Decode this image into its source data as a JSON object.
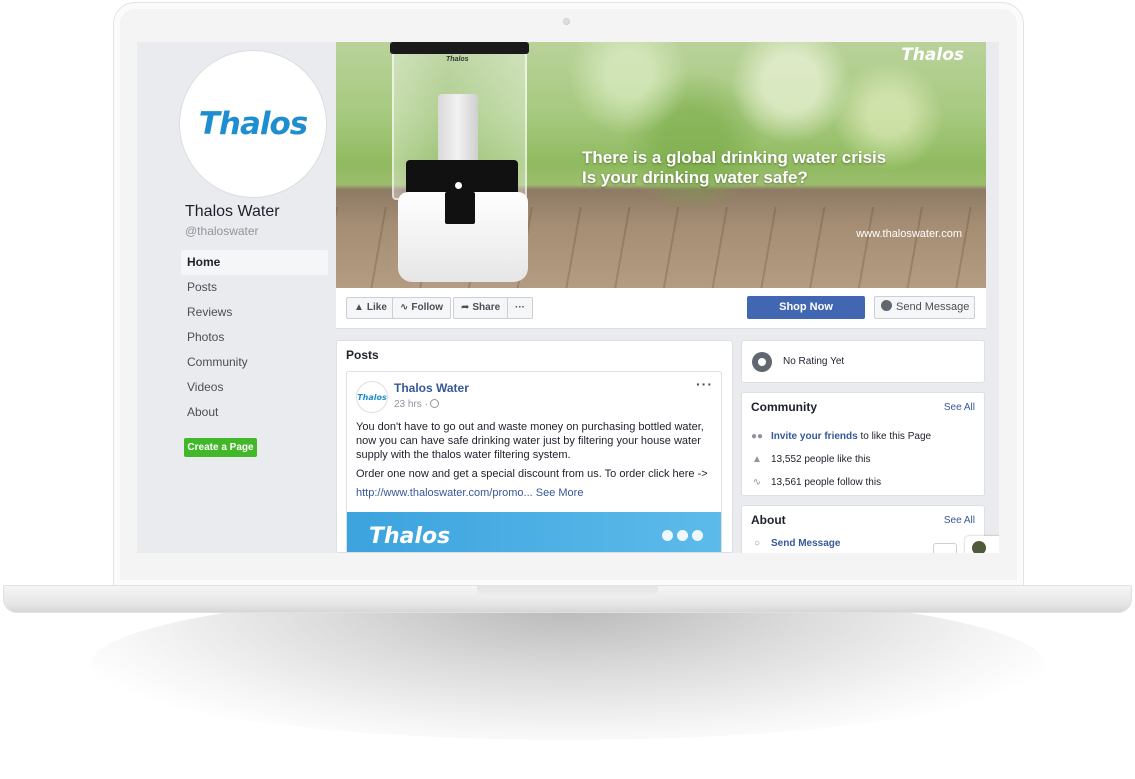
{
  "page": {
    "name": "Thalos Water",
    "handle": "@thaloswater",
    "logo_text": "Thalos"
  },
  "sidebar": {
    "items": [
      {
        "label": "Home",
        "active": true
      },
      {
        "label": "Posts"
      },
      {
        "label": "Reviews"
      },
      {
        "label": "Photos"
      },
      {
        "label": "Community"
      },
      {
        "label": "Videos"
      },
      {
        "label": "About"
      }
    ],
    "create_page_label": "Create a Page"
  },
  "cover": {
    "brand": "Thalos",
    "device_brand": "Thalos",
    "headline_line1": "There is a global drinking water crisis",
    "headline_line2": "Is your drinking water safe?",
    "url": "www.thaloswater.com"
  },
  "actions": {
    "like": "Like",
    "follow": "Follow",
    "share": "Share",
    "more": "···",
    "shop_now": "Shop Now",
    "send_message": "Send Message"
  },
  "posts": {
    "title": "Posts",
    "post": {
      "author": "Thalos Water",
      "avatar_text": "Thalos",
      "time": "23 hrs ·",
      "more": "···",
      "paragraph1": "You don't have to go out and waste money on purchasing bottled water, now you can have safe drinking water just by filtering your house water supply with the thalos water filtering system.",
      "paragraph2": "Order one now and get a special discount from us. To order click here ->",
      "link": "http://www.thaloswater.com/promo...",
      "see_more": "See More",
      "banner_logo": "Thalos"
    }
  },
  "rating": {
    "text": "No Rating Yet"
  },
  "community": {
    "title": "Community",
    "see_all": "See All",
    "invite_link": "Invite your friends",
    "invite_rest": " to like this Page",
    "likes": "13,552 people like this",
    "follows": "13,561 people follow this"
  },
  "about": {
    "title": "About",
    "see_all": "See All",
    "send_message": "Send Message"
  },
  "colors": {
    "facebook_blue": "#4267b2",
    "link_blue": "#365899",
    "create_green": "#42b72a",
    "brand_blue": "#1f8ed0",
    "page_bg": "#e9ebee"
  }
}
